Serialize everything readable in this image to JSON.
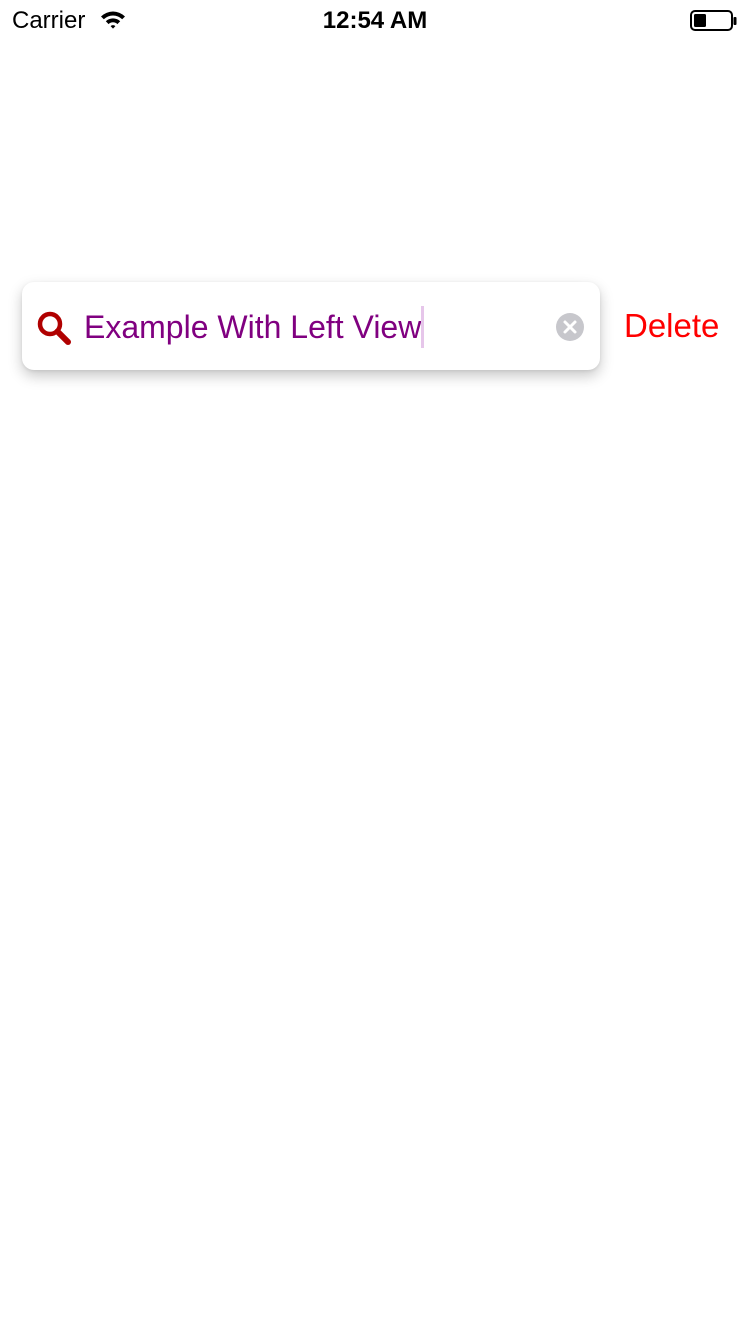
{
  "status_bar": {
    "carrier": "Carrier",
    "time": "12:54 AM",
    "icons": [
      "wifi-icon",
      "battery-icon"
    ],
    "battery_level": 0.35
  },
  "search_field": {
    "value": "Example With Left View",
    "icon": "search-icon",
    "clear_icon": "clear-icon",
    "text_color": "#800080",
    "icon_color": "#B00000"
  },
  "delete_button": {
    "label": "Delete",
    "color": "#FF0000"
  }
}
